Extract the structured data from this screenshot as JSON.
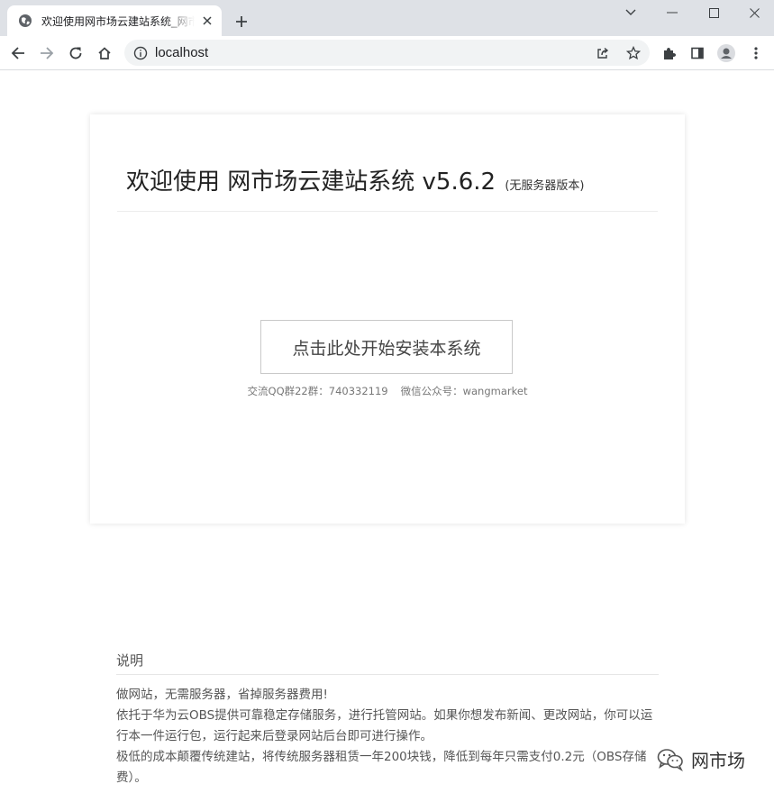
{
  "browser": {
    "tab_title": "欢迎使用网市场云建站系统_网市场",
    "url": "localhost",
    "icons": {
      "favicon": "globe-icon",
      "tab_close": "close-icon",
      "new_tab": "plus-icon",
      "back": "arrow-left-icon",
      "forward": "arrow-right-icon",
      "reload": "reload-icon",
      "home": "home-icon",
      "site_info": "info-icon",
      "share": "share-icon",
      "bookmark": "star-icon",
      "extensions": "puzzle-icon",
      "side_panel": "side-panel-icon",
      "profile": "profile-icon",
      "menu": "kebab-menu-icon",
      "tab_search": "chevron-down-icon",
      "minimize": "minimize-icon",
      "maximize": "maximize-icon",
      "close_window": "close-window-icon"
    }
  },
  "page": {
    "title": "欢迎使用 网市场云建站系统 v5.6.2",
    "edition": "(无服务器版本)",
    "install_button": "点击此处开始安装本系统",
    "qq_group": "交流QQ群22群：740332119",
    "wechat": "微信公众号：wangmarket",
    "notes_heading": "说明",
    "notes": [
      "做网站，无需服务器，省掉服务器费用!",
      "依托于华为云OBS提供可靠稳定存储服务，进行托管网站。如果你想发布新闻、更改网站，你可以运行本一件运行包，运行起来后登录网站后台即可进行操作。",
      "极低的成本颠覆传统建站，将传统服务器租赁一年200块钱，降低到每年只需支付0.2元（OBS存储费）。"
    ]
  },
  "watermark": {
    "text": "网市场",
    "icon": "wechat-logo-icon"
  },
  "colors": {
    "tabstrip": "#dee1e6",
    "omnibox": "#f1f3f4",
    "card_border": "#c9c9c9",
    "text_muted": "#777777"
  }
}
